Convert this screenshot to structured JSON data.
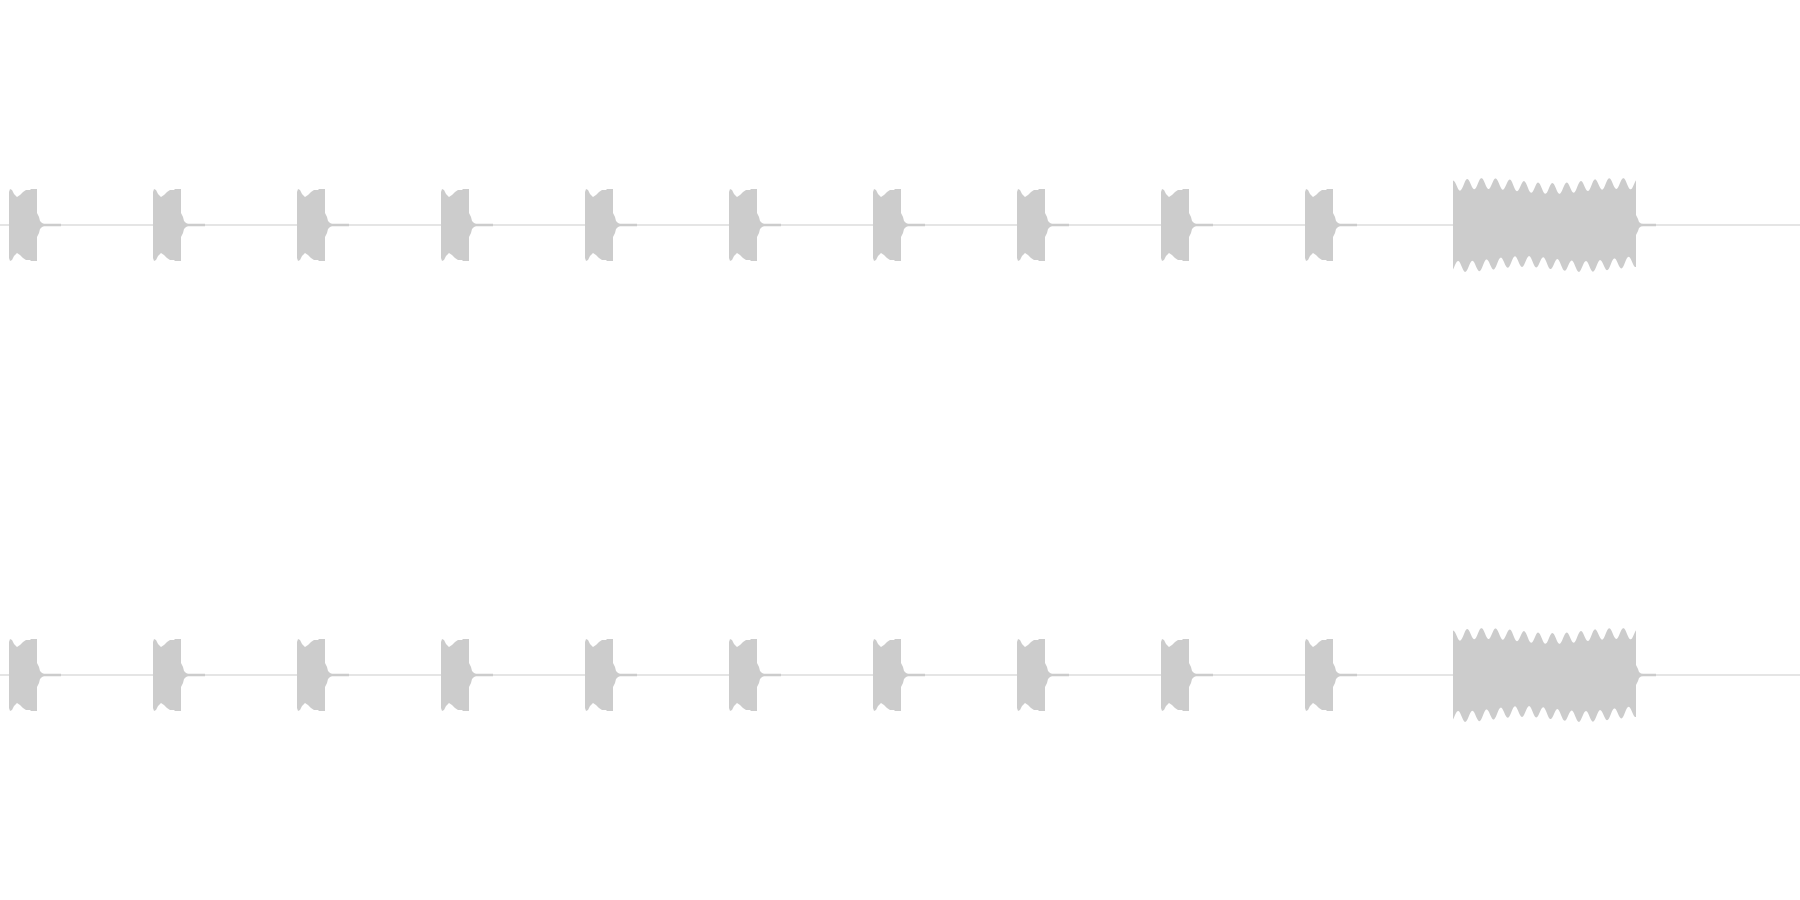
{
  "tracks": [
    {
      "kind": "waveform"
    },
    {
      "kind": "waveform"
    }
  ]
}
